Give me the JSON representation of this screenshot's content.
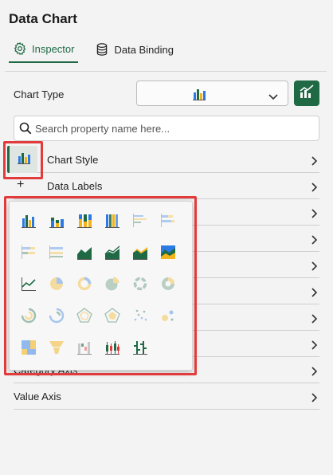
{
  "header": {
    "title": "Data Chart"
  },
  "tabs": [
    {
      "label": "Inspector",
      "icon": "gear-icon",
      "active": true
    },
    {
      "label": "Data Binding",
      "icon": "database-icon",
      "active": false
    }
  ],
  "chart_type": {
    "label": "Chart Type",
    "selected_icon": "column-chart-icon"
  },
  "search": {
    "placeholder": "Search property name here..."
  },
  "sections": [
    {
      "label": "Chart Style",
      "expanded": false
    },
    {
      "label": "Data Labels"
    },
    {
      "label": ""
    },
    {
      "label": ""
    },
    {
      "label": ""
    },
    {
      "label": ""
    },
    {
      "label": ""
    },
    {
      "label": ""
    },
    {
      "label": "Category Axis"
    },
    {
      "label": "Value Axis"
    }
  ],
  "chart_gallery": [
    [
      "column",
      "stacked-column",
      "100-stacked-column",
      "column-4",
      "bar",
      "stacked-bar"
    ],
    [
      "100-stacked-bar",
      "bar-4",
      "area",
      "stacked-area",
      "100-stacked-area",
      "area-4"
    ],
    [
      "line",
      "pie",
      "doughnut",
      "pie-exploded",
      "doughnut-exploded",
      "sunburst"
    ],
    [
      "radial-bar",
      "radial-bar-2",
      "radar",
      "radar-filled",
      "scatter",
      "bubble"
    ],
    [
      "treemap",
      "funnel",
      "waterfall",
      "candlestick",
      "ohlc"
    ]
  ],
  "colors": {
    "accent": "#1f6a45",
    "highlight": "#e23b3b",
    "icon_green": "#1f6a45",
    "icon_yellow": "#f3b41b",
    "icon_blue": "#2c7be5"
  }
}
